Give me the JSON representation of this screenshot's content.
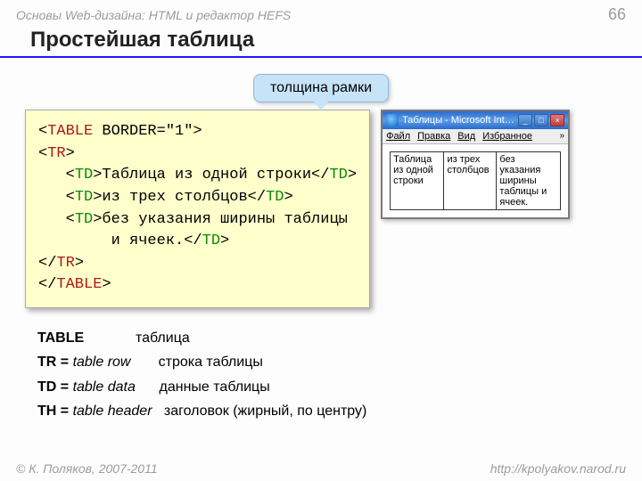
{
  "header": {
    "course": "Основы Web-дизайна: HTML и редактор HEFS",
    "page_num": "66"
  },
  "title": "Простейшая таблица",
  "callout": "толщина рамки",
  "code": {
    "l1a": "<",
    "l1b": "TABLE",
    "l1c": " BORDER=\"1\">",
    "l2a": "<",
    "l2b": "TR",
    "l2c": ">",
    "l3a": "   <",
    "l3b": "TD",
    "l3c": ">Таблица из одной строки</",
    "l3d": "TD",
    "l3e": ">",
    "l4a": "   <",
    "l4b": "TD",
    "l4c": ">из трех столбцов</",
    "l4d": "TD",
    "l4e": ">",
    "l5a": "   <",
    "l5b": "TD",
    "l5c": ">без указания ширины таблицы",
    "l6": "        и ячеек.</",
    "l6b": "TD",
    "l6c": ">",
    "l7a": "</",
    "l7b": "TR",
    "l7c": ">",
    "l8a": "</",
    "l8b": "TABLE",
    "l8c": ">"
  },
  "browser": {
    "title": "Таблицы - Microsoft Internet E…",
    "menu": {
      "file": "Файл",
      "edit": "Правка",
      "view": "Вид",
      "fav": "Избранное"
    },
    "cells": {
      "c1": "Таблица из одной строки",
      "c2": "из трех столбцов",
      "c3": "без указания ширины таблицы и ячеек."
    }
  },
  "defs": {
    "r1a": "TABLE",
    "r1b": "таблица",
    "r2a": "TR = ",
    "r2ai": "table row",
    "r2b": "строка таблицы",
    "r3a": "TD = ",
    "r3ai": "table data",
    "r3b": "данные таблицы",
    "r4a": "TH = ",
    "r4ai": "table header",
    "r4b": "заголовок (жирный, по центру)"
  },
  "footer": {
    "left": "© К. Поляков, 2007-2011",
    "right": "http://kpolyakov.narod.ru"
  }
}
